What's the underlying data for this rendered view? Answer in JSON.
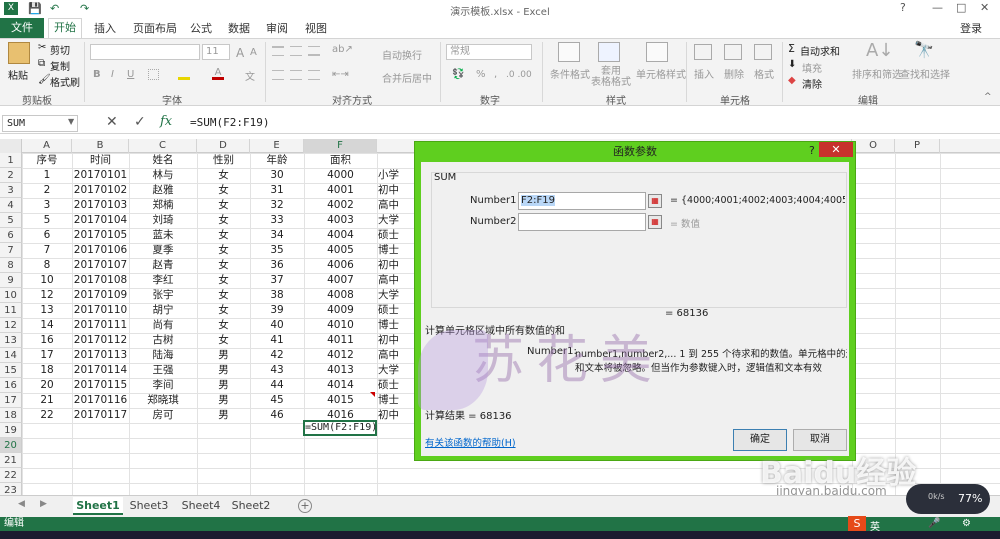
{
  "window": {
    "title": "演示模板.xlsx - Excel",
    "login": "登录",
    "controls": [
      "?",
      "—",
      "□",
      "✕"
    ]
  },
  "ribbon_tabs": [
    "文件",
    "开始",
    "插入",
    "页面布局",
    "公式",
    "数据",
    "审阅",
    "视图"
  ],
  "ribbon": {
    "clipboard": {
      "paste": "粘贴",
      "cut": "剪切",
      "copy": "复制",
      "format_painter": "格式刷",
      "group": "剪贴板"
    },
    "font": {
      "font_size": "11",
      "bold": "B",
      "italic": "I",
      "underline": "U",
      "size_up": "A",
      "size_down": "A",
      "phonetic": "文",
      "group": "字体"
    },
    "alignment": {
      "wrap": "自动换行",
      "merge": "合并后居中",
      "group": "对齐方式"
    },
    "number": {
      "format": "常规",
      "percent": "%",
      "comma": ",",
      "group": "数字"
    },
    "styles": {
      "conditional": "条件格式",
      "table": "套用\n表格格式",
      "cell_styles": "单元格样式",
      "group": "样式"
    },
    "cells": {
      "insert": "插入",
      "delete": "删除",
      "format": "格式",
      "group": "单元格"
    },
    "editing": {
      "autosum": "自动求和",
      "fill": "填充",
      "clear": "清除",
      "sort": "排序和筛选",
      "find": "查找和选择",
      "group": "编辑"
    }
  },
  "formula_bar": {
    "name_box": "SUM",
    "cancel": "✕",
    "enter": "✓",
    "fx": "fx",
    "formula": "=SUM(F2:F19)"
  },
  "columns": [
    "A",
    "B",
    "C",
    "D",
    "E",
    "F",
    "G",
    "O",
    "P"
  ],
  "headers": [
    "序号",
    "时间",
    "姓名",
    "性别",
    "年龄",
    "面积",
    "学历"
  ],
  "rows": [
    [
      "1",
      "20170101",
      "林与",
      "女",
      "30",
      "4000",
      "小学"
    ],
    [
      "2",
      "20170102",
      "赵雅",
      "女",
      "31",
      "4001",
      "初中"
    ],
    [
      "3",
      "20170103",
      "郑楠",
      "女",
      "32",
      "4002",
      "高中"
    ],
    [
      "5",
      "20170104",
      "刘琦",
      "女",
      "33",
      "4003",
      "大学"
    ],
    [
      "6",
      "20170105",
      "蓝未",
      "女",
      "34",
      "4004",
      "硕士"
    ],
    [
      "7",
      "20170106",
      "夏季",
      "女",
      "35",
      "4005",
      "博士"
    ],
    [
      "8",
      "20170107",
      "赵青",
      "女",
      "36",
      "4006",
      "初中"
    ],
    [
      "10",
      "20170108",
      "李红",
      "女",
      "37",
      "4007",
      "高中"
    ],
    [
      "12",
      "20170109",
      "张宇",
      "女",
      "38",
      "4008",
      "大学"
    ],
    [
      "13",
      "20170110",
      "胡宁",
      "女",
      "39",
      "4009",
      "硕士"
    ],
    [
      "14",
      "20170111",
      "尚有",
      "女",
      "40",
      "4010",
      "博士"
    ],
    [
      "16",
      "20170112",
      "古树",
      "女",
      "41",
      "4011",
      "初中"
    ],
    [
      "17",
      "20170113",
      "陆海",
      "男",
      "42",
      "4012",
      "高中"
    ],
    [
      "18",
      "20170114",
      "王强",
      "男",
      "43",
      "4013",
      "大学"
    ],
    [
      "20",
      "20170115",
      "李间",
      "男",
      "44",
      "4014",
      "硕士"
    ],
    [
      "21",
      "20170116",
      "郑晓琪",
      "男",
      "45",
      "4015",
      "博士"
    ],
    [
      "22",
      "20170117",
      "房可",
      "男",
      "46",
      "4016",
      "初中"
    ]
  ],
  "row_numbers": [
    "1",
    "2",
    "3",
    "4",
    "5",
    "6",
    "7",
    "8",
    "9",
    "10",
    "11",
    "12",
    "13",
    "14",
    "15",
    "16",
    "17",
    "18",
    "19",
    "20",
    "21",
    "22",
    "23",
    "24",
    "25"
  ],
  "active_cell": {
    "value": "=SUM(F2:F19)"
  },
  "dialog": {
    "title": "函数参数",
    "help_glyph": "?",
    "close": "✕",
    "func_name": "SUM",
    "number1_label": "Number1",
    "number1_value": "F2:F19",
    "number1_result": "= {4000;4001;4002;4003;4004;4005...",
    "number2_label": "Number2",
    "number2_result": "= 数值",
    "total": "=   68136",
    "description": "计算单元格区域中所有数值的和",
    "arg_label": "Number1:",
    "arg_desc_1": "number1,number2,...  1 到 255 个待求和的数值。单元格中的逻辑值",
    "arg_desc_2": "和文本将被忽略。但当作为参数键入时，逻辑值和文本有效",
    "result_label": "计算结果 =   68136",
    "help_link": "有关该函数的帮助(H)",
    "ok": "确定",
    "cancel": "取消"
  },
  "sheets": [
    "Sheet1",
    "Sheet3",
    "Sheet4",
    "Sheet2"
  ],
  "active_sheet": "Sheet1",
  "status": "编辑",
  "watermark": "苏花美",
  "baidu": {
    "logo": "Baidu经验",
    "url": "jingyan.baidu.com"
  },
  "gauge": {
    "percent": "77%",
    "speed": "0k/s"
  },
  "ime": {
    "label": "英"
  }
}
